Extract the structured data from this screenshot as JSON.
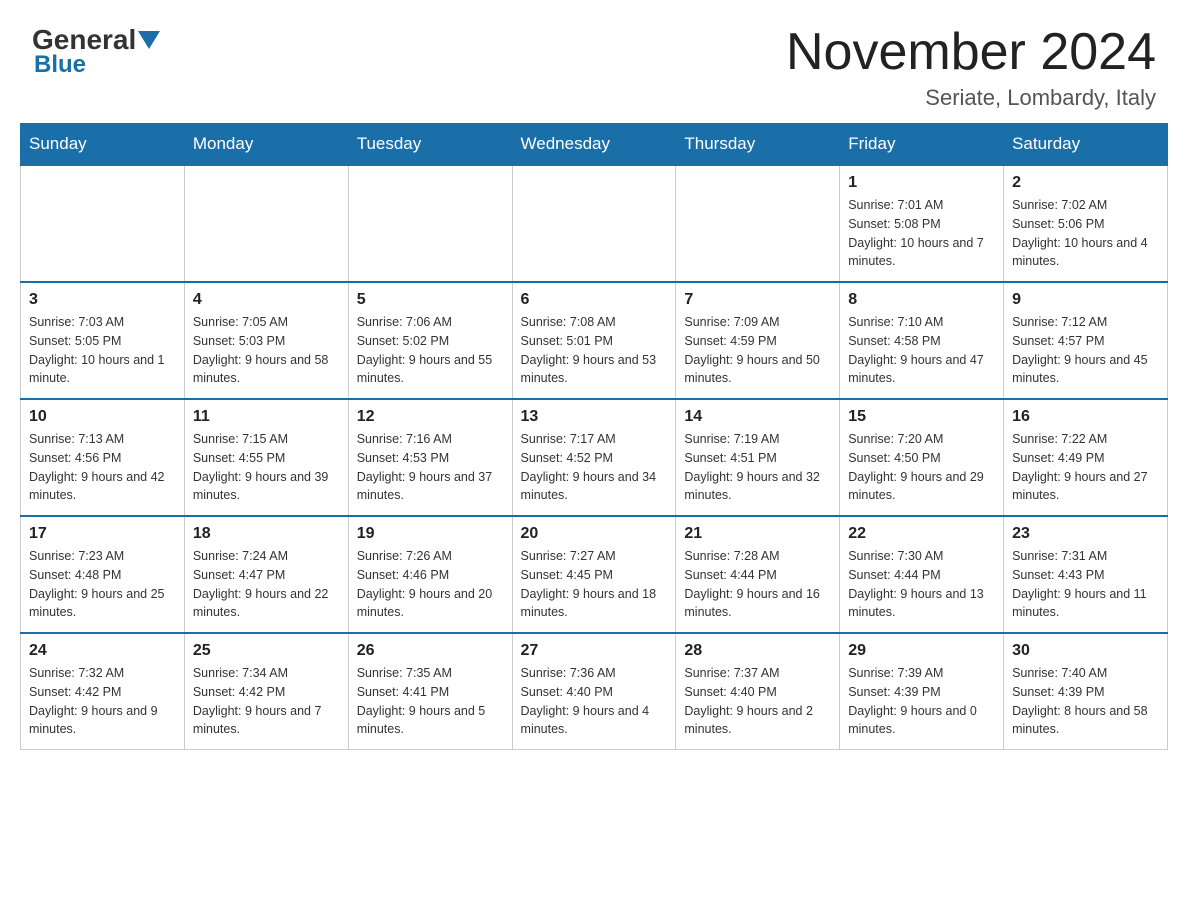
{
  "header": {
    "logo": {
      "general": "General",
      "blue": "Blue"
    },
    "title": "November 2024",
    "subtitle": "Seriate, Lombardy, Italy"
  },
  "calendar": {
    "days_of_week": [
      "Sunday",
      "Monday",
      "Tuesday",
      "Wednesday",
      "Thursday",
      "Friday",
      "Saturday"
    ],
    "weeks": [
      {
        "days": [
          {
            "number": "",
            "info": ""
          },
          {
            "number": "",
            "info": ""
          },
          {
            "number": "",
            "info": ""
          },
          {
            "number": "",
            "info": ""
          },
          {
            "number": "",
            "info": ""
          },
          {
            "number": "1",
            "info": "Sunrise: 7:01 AM\nSunset: 5:08 PM\nDaylight: 10 hours and 7 minutes."
          },
          {
            "number": "2",
            "info": "Sunrise: 7:02 AM\nSunset: 5:06 PM\nDaylight: 10 hours and 4 minutes."
          }
        ]
      },
      {
        "days": [
          {
            "number": "3",
            "info": "Sunrise: 7:03 AM\nSunset: 5:05 PM\nDaylight: 10 hours and 1 minute."
          },
          {
            "number": "4",
            "info": "Sunrise: 7:05 AM\nSunset: 5:03 PM\nDaylight: 9 hours and 58 minutes."
          },
          {
            "number": "5",
            "info": "Sunrise: 7:06 AM\nSunset: 5:02 PM\nDaylight: 9 hours and 55 minutes."
          },
          {
            "number": "6",
            "info": "Sunrise: 7:08 AM\nSunset: 5:01 PM\nDaylight: 9 hours and 53 minutes."
          },
          {
            "number": "7",
            "info": "Sunrise: 7:09 AM\nSunset: 4:59 PM\nDaylight: 9 hours and 50 minutes."
          },
          {
            "number": "8",
            "info": "Sunrise: 7:10 AM\nSunset: 4:58 PM\nDaylight: 9 hours and 47 minutes."
          },
          {
            "number": "9",
            "info": "Sunrise: 7:12 AM\nSunset: 4:57 PM\nDaylight: 9 hours and 45 minutes."
          }
        ]
      },
      {
        "days": [
          {
            "number": "10",
            "info": "Sunrise: 7:13 AM\nSunset: 4:56 PM\nDaylight: 9 hours and 42 minutes."
          },
          {
            "number": "11",
            "info": "Sunrise: 7:15 AM\nSunset: 4:55 PM\nDaylight: 9 hours and 39 minutes."
          },
          {
            "number": "12",
            "info": "Sunrise: 7:16 AM\nSunset: 4:53 PM\nDaylight: 9 hours and 37 minutes."
          },
          {
            "number": "13",
            "info": "Sunrise: 7:17 AM\nSunset: 4:52 PM\nDaylight: 9 hours and 34 minutes."
          },
          {
            "number": "14",
            "info": "Sunrise: 7:19 AM\nSunset: 4:51 PM\nDaylight: 9 hours and 32 minutes."
          },
          {
            "number": "15",
            "info": "Sunrise: 7:20 AM\nSunset: 4:50 PM\nDaylight: 9 hours and 29 minutes."
          },
          {
            "number": "16",
            "info": "Sunrise: 7:22 AM\nSunset: 4:49 PM\nDaylight: 9 hours and 27 minutes."
          }
        ]
      },
      {
        "days": [
          {
            "number": "17",
            "info": "Sunrise: 7:23 AM\nSunset: 4:48 PM\nDaylight: 9 hours and 25 minutes."
          },
          {
            "number": "18",
            "info": "Sunrise: 7:24 AM\nSunset: 4:47 PM\nDaylight: 9 hours and 22 minutes."
          },
          {
            "number": "19",
            "info": "Sunrise: 7:26 AM\nSunset: 4:46 PM\nDaylight: 9 hours and 20 minutes."
          },
          {
            "number": "20",
            "info": "Sunrise: 7:27 AM\nSunset: 4:45 PM\nDaylight: 9 hours and 18 minutes."
          },
          {
            "number": "21",
            "info": "Sunrise: 7:28 AM\nSunset: 4:44 PM\nDaylight: 9 hours and 16 minutes."
          },
          {
            "number": "22",
            "info": "Sunrise: 7:30 AM\nSunset: 4:44 PM\nDaylight: 9 hours and 13 minutes."
          },
          {
            "number": "23",
            "info": "Sunrise: 7:31 AM\nSunset: 4:43 PM\nDaylight: 9 hours and 11 minutes."
          }
        ]
      },
      {
        "days": [
          {
            "number": "24",
            "info": "Sunrise: 7:32 AM\nSunset: 4:42 PM\nDaylight: 9 hours and 9 minutes."
          },
          {
            "number": "25",
            "info": "Sunrise: 7:34 AM\nSunset: 4:42 PM\nDaylight: 9 hours and 7 minutes."
          },
          {
            "number": "26",
            "info": "Sunrise: 7:35 AM\nSunset: 4:41 PM\nDaylight: 9 hours and 5 minutes."
          },
          {
            "number": "27",
            "info": "Sunrise: 7:36 AM\nSunset: 4:40 PM\nDaylight: 9 hours and 4 minutes."
          },
          {
            "number": "28",
            "info": "Sunrise: 7:37 AM\nSunset: 4:40 PM\nDaylight: 9 hours and 2 minutes."
          },
          {
            "number": "29",
            "info": "Sunrise: 7:39 AM\nSunset: 4:39 PM\nDaylight: 9 hours and 0 minutes."
          },
          {
            "number": "30",
            "info": "Sunrise: 7:40 AM\nSunset: 4:39 PM\nDaylight: 8 hours and 58 minutes."
          }
        ]
      }
    ]
  }
}
